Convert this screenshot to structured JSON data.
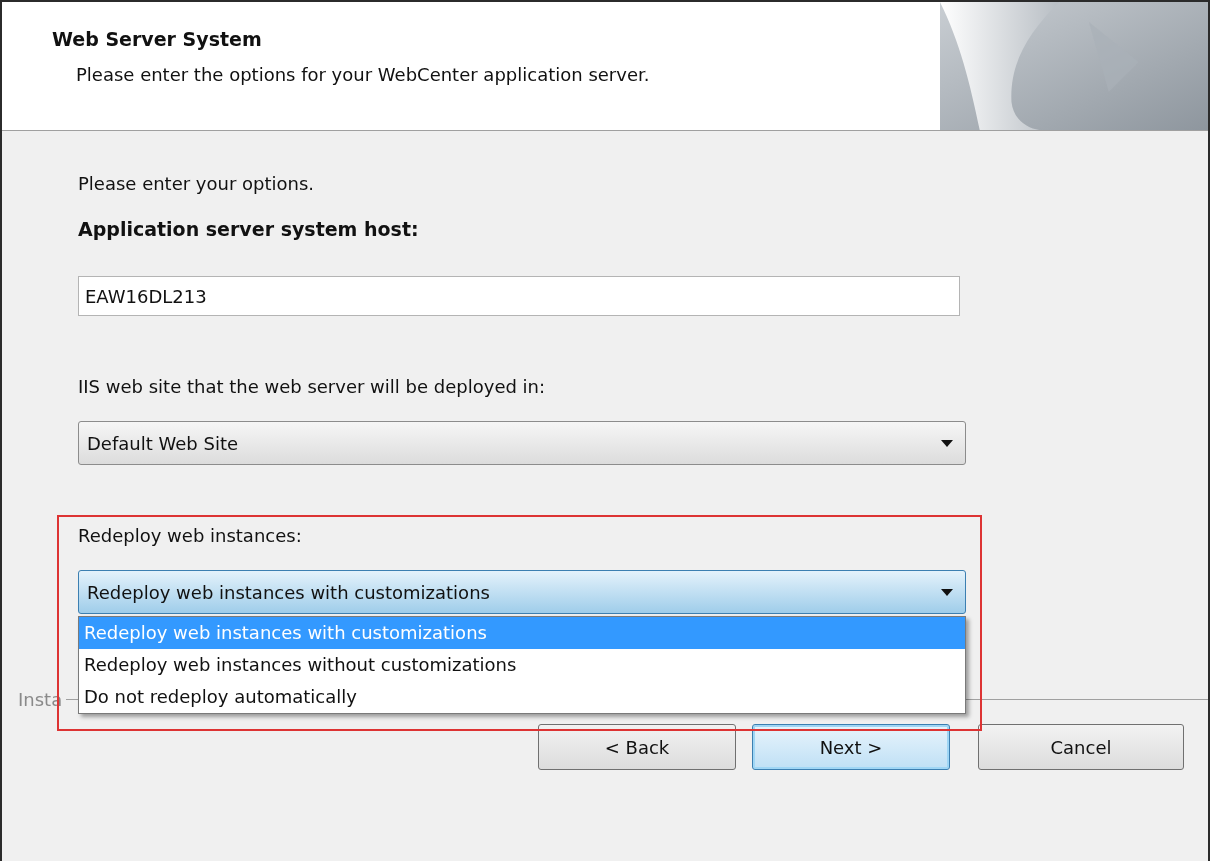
{
  "header": {
    "title": "Web Server System",
    "subtitle": "Please enter the options for your WebCenter application server."
  },
  "intro": "Please enter your options.",
  "host": {
    "label": "Application server system host:",
    "value": "EAW16DL213"
  },
  "site": {
    "label": "IIS web site that the web server will be deployed in:",
    "value": "Default Web Site"
  },
  "redeploy": {
    "label": "Redeploy web instances:",
    "value": "Redeploy web instances with customizations",
    "expanded": true,
    "highlighted": true,
    "options": [
      {
        "label": "Redeploy web instances with customizations",
        "selected": true
      },
      {
        "label": "Redeploy web instances without customizations",
        "selected": false
      },
      {
        "label": "Do not redeploy automatically",
        "selected": false
      }
    ]
  },
  "brand": "Insta",
  "buttons": [
    {
      "label": "< Back",
      "kind": "normal"
    },
    {
      "label": "Next >",
      "kind": "default"
    },
    {
      "label": "Cancel",
      "kind": "normal"
    }
  ]
}
